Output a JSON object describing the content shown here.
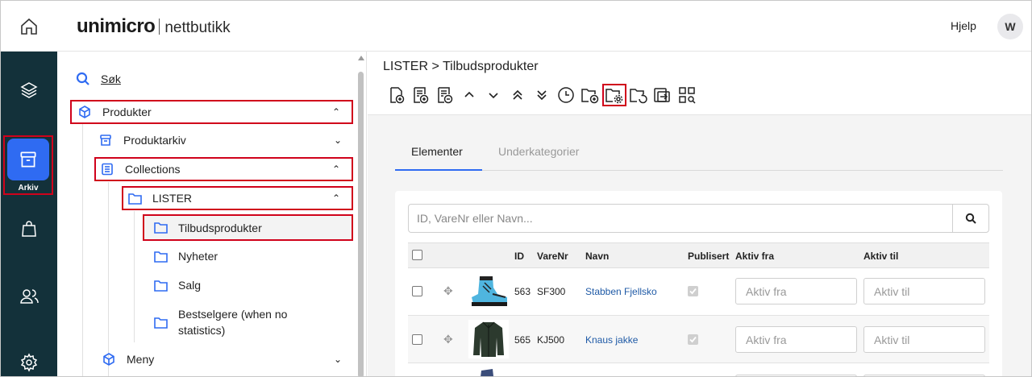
{
  "header": {
    "logo_main": "unimicro",
    "logo_sub": "nettbutikk",
    "help_label": "Hjelp",
    "avatar_initial": "W"
  },
  "rail": {
    "items": [
      {
        "icon": "layers-icon"
      },
      {
        "icon": "archive-icon",
        "label": "Arkiv",
        "active": true
      },
      {
        "icon": "shopping-bag-icon"
      },
      {
        "icon": "users-icon"
      },
      {
        "icon": "gear-icon"
      }
    ],
    "accent": "#2f6bf2",
    "background": "#13313a"
  },
  "tree": {
    "search_label": "Søk",
    "produkter_label": "Produkter",
    "produktarkiv_label": "Produktarkiv",
    "collections_label": "Collections",
    "lister_label": "LISTER",
    "tilbud_label": "Tilbudsprodukter",
    "nyheter_label": "Nyheter",
    "salg_label": "Salg",
    "bestselgere_line1": "Bestselgere (when no",
    "bestselgere_line2": "statistics)",
    "meny_label": "Meny"
  },
  "main": {
    "breadcrumb": "LISTER > Tilbudsprodukter",
    "tabs": [
      {
        "label": "Elementer",
        "active": true
      },
      {
        "label": "Underkategorier",
        "active": false
      }
    ],
    "search_placeholder": "ID, VareNr eller Navn...",
    "columns": {
      "id": "ID",
      "varenr": "VareNr",
      "navn": "Navn",
      "publisert": "Publisert",
      "aktiv_fra": "Aktiv fra",
      "aktiv_til": "Aktiv til"
    },
    "rows": [
      {
        "id": "563",
        "varenr": "SF300",
        "navn": "Stabben Fjellsko",
        "publisert": true,
        "aktiv_fra_placeholder": "Aktiv fra",
        "aktiv_til_placeholder": "Aktiv til",
        "image": "boot"
      },
      {
        "id": "565",
        "varenr": "KJ500",
        "navn": "Knaus jakke",
        "publisert": true,
        "aktiv_fra_placeholder": "Aktiv fra",
        "aktiv_til_placeholder": "Aktiv til",
        "image": "jacket"
      }
    ]
  },
  "colors": {
    "highlight": "#d0021b",
    "link": "#1f5aa6",
    "tree_icon": "#2f6bf2"
  }
}
